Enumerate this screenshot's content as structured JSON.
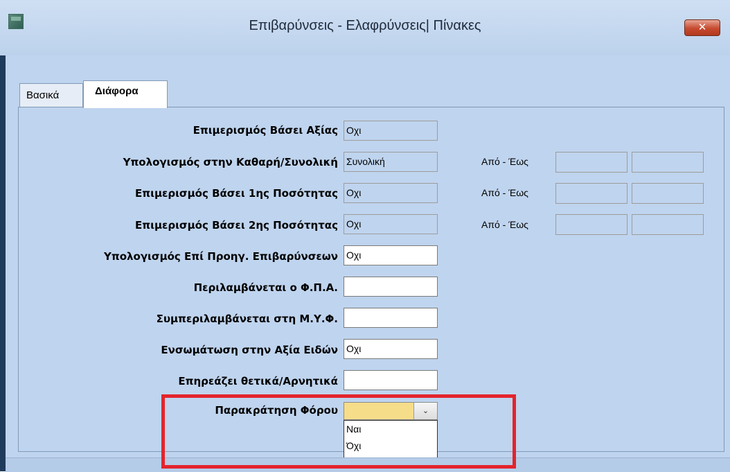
{
  "window": {
    "title": "Επιβαρύνσεις - Ελαφρύνσεις| Πίνακες",
    "close_label": "✕"
  },
  "tabs": [
    {
      "label": "Βασικά",
      "active": false
    },
    {
      "label": "Διάφορα",
      "active": true
    }
  ],
  "form": {
    "rows": [
      {
        "label": "Επιμερισμός Βάσει Αξίας",
        "value": "Οχι",
        "editable": false
      },
      {
        "label": "Υπολογισμός στην Καθαρή/Συνολική",
        "value": "Συνολική",
        "editable": false,
        "range_label": "Από - Έως"
      },
      {
        "label": "Επιμερισμός Βάσει 1ης Ποσότητας",
        "value": "Οχι",
        "editable": false,
        "range_label": "Από - Έως"
      },
      {
        "label": "Επιμερισμός Βάσει 2ης Ποσότητας",
        "value": "Οχι",
        "editable": false,
        "range_label": "Από - Έως"
      },
      {
        "label": "Υπολογισμός Επί Προηγ. Επιβαρύνσεων",
        "value": "Οχι",
        "editable": true
      },
      {
        "label": "Περιλαμβάνεται ο Φ.Π.Α.",
        "value": "",
        "editable": true
      },
      {
        "label": "Συμπεριλαμβάνεται στη Μ.Υ.Φ.",
        "value": "",
        "editable": true
      },
      {
        "label": "Ενσωμάτωση στην Αξία Ειδών",
        "value": "Οχι",
        "editable": true
      },
      {
        "label": "Επηρεάζει θετικά/Αρνητικά",
        "value": "",
        "editable": true
      }
    ],
    "withholding": {
      "label": "Παρακράτηση Φόρου",
      "value": "",
      "arrow": "⌄",
      "options": [
        "Ναι",
        "Όχι"
      ]
    }
  },
  "colors": {
    "window_bg": "#bfd4ee",
    "combo_bg": "#f6dd8a",
    "highlight": "#e4242c"
  }
}
